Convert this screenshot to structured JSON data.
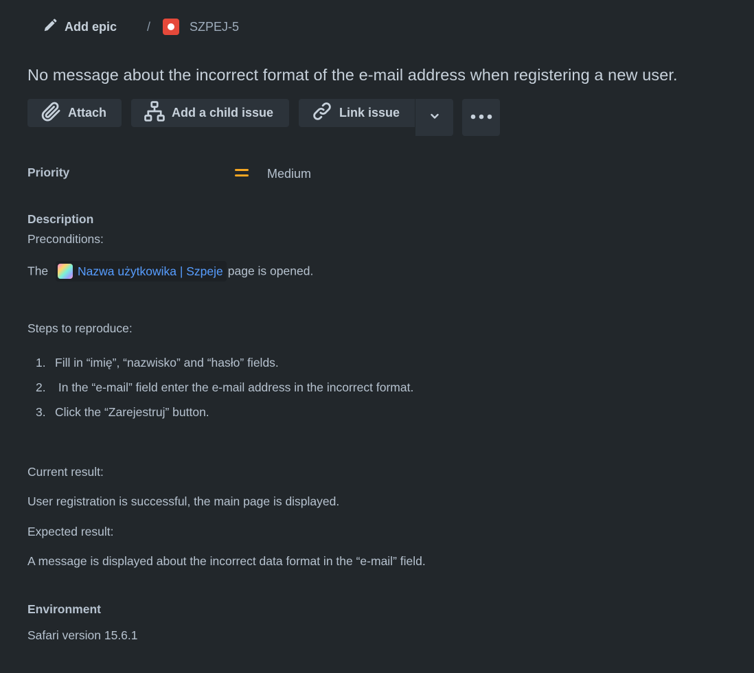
{
  "breadcrumb": {
    "add_epic_label": "Add epic",
    "separator": "/",
    "issue_key": "SZPEJ-5",
    "issue_type_color": "#e5493a"
  },
  "issue": {
    "title": "No message about the incorrect format of the e-mail address when registering a new user."
  },
  "toolbar": {
    "attach_label": "Attach",
    "add_child_label": "Add a child issue",
    "link_issue_label": "Link issue",
    "link_dropdown_icon": "chevron-down-icon",
    "more_icon": "more-icon"
  },
  "priority": {
    "label": "Priority",
    "value": "Medium",
    "icon_color": "#f5a623"
  },
  "description": {
    "label": "Description",
    "preconditions_heading": "Preconditions:",
    "precondition_prefix": "The",
    "link_text": "Nazwa użytkowika | Szpeje",
    "precondition_suffix": "page is opened.",
    "steps_heading": "Steps to reproduce:",
    "steps": [
      {
        "num": "1.",
        "text": "Fill in “imię”, “nazwisko” and “hasło” fields."
      },
      {
        "num": "2.",
        "text": " In the “e-mail” field enter the e-mail address in the incorrect format."
      },
      {
        "num": "3.",
        "text": "Click the “Zarejestruj” button."
      }
    ],
    "current_heading": "Current result:",
    "current_text": "User registration is successful, the main page is displayed.",
    "expected_heading": "Expected result:",
    "expected_text": "A message is displayed about the incorrect data format in the “e-mail” field."
  },
  "environment": {
    "label": "Environment",
    "value": "Safari version 15.6.1"
  },
  "colors": {
    "background": "#22272b",
    "button_bg": "#2c333a",
    "link": "#579dff"
  }
}
